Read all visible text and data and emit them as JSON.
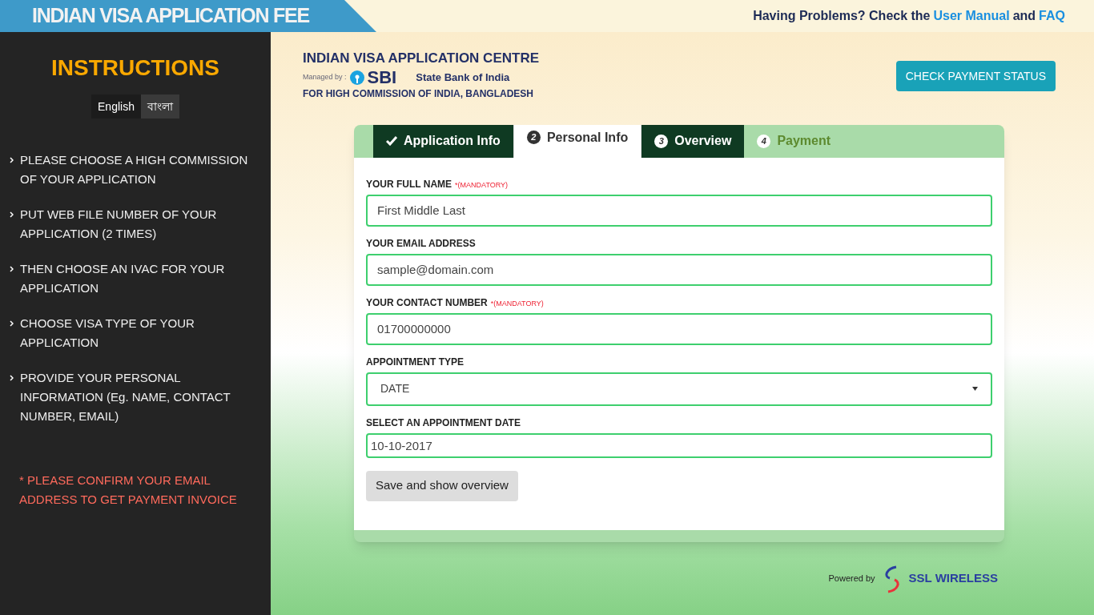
{
  "header": {
    "title": "INDIAN VISA APPLICATION FEE",
    "help_prefix": "Having Problems? Check the",
    "help_link_1": "User Manual",
    "help_and": "and",
    "help_link_2": "FAQ"
  },
  "sidebar": {
    "title": "INSTRUCTIONS",
    "languages": [
      {
        "label": "English",
        "selected": true
      },
      {
        "label": "বাংলা",
        "selected": false
      }
    ],
    "items": [
      "PLEASE CHOOSE A HIGH COMMISSION OF YOUR APPLICATION",
      "PUT WEB FILE NUMBER OF YOUR APPLICATION (2 TIMES)",
      "THEN CHOOSE AN IVAC FOR YOUR APPLICATION",
      "CHOOSE VISA TYPE OF YOUR APPLICATION",
      "PROVIDE YOUR PERSONAL INFORMATION (Eg. NAME, CONTACT NUMBER, EMAIL)"
    ],
    "note": "* PLEASE CONFIRM YOUR EMAIL ADDRESS TO GET PAYMENT INVOICE"
  },
  "logo": {
    "title": "INDIAN VISA APPLICATION CENTRE",
    "managed_by": "Managed by :",
    "bank_short": "SBI",
    "bank_name": "State Bank of India",
    "subtitle": "FOR HIGH COMMISSION OF INDIA, BANGLADESH"
  },
  "check_status_button": "CHECK PAYMENT STATUS",
  "tabs": [
    {
      "label": "Application Info",
      "selected": false,
      "completed": true,
      "disabled": false
    },
    {
      "label": "Personal Info",
      "number": "2",
      "selected": true,
      "completed": false,
      "disabled": false
    },
    {
      "label": "Overview",
      "number": "3",
      "selected": false,
      "completed": false,
      "disabled": false
    },
    {
      "label": "Payment",
      "number": "4",
      "selected": false,
      "completed": false,
      "disabled": true
    }
  ],
  "fields": [
    {
      "kind": "text",
      "label": "YOUR FULL NAME",
      "mandatory": "*(MANDATORY)",
      "value": "First Middle Last"
    },
    {
      "kind": "text",
      "label": "YOUR EMAIL ADDRESS",
      "value": "sample@domain.com"
    },
    {
      "kind": "text",
      "label": "YOUR CONTACT NUMBER",
      "mandatory": "*(MANDATORY)",
      "value": "01700000000"
    },
    {
      "kind": "select",
      "label": "APPOINTMENT TYPE",
      "value": "DATE"
    },
    {
      "kind": "date",
      "label": "SELECT AN APPOINTMENT DATE",
      "value": "10-10-2017"
    }
  ],
  "submit_button": "Save and show overview",
  "footer": {
    "powered_by": "Powered by",
    "brand": "SSL WIRELESS"
  }
}
